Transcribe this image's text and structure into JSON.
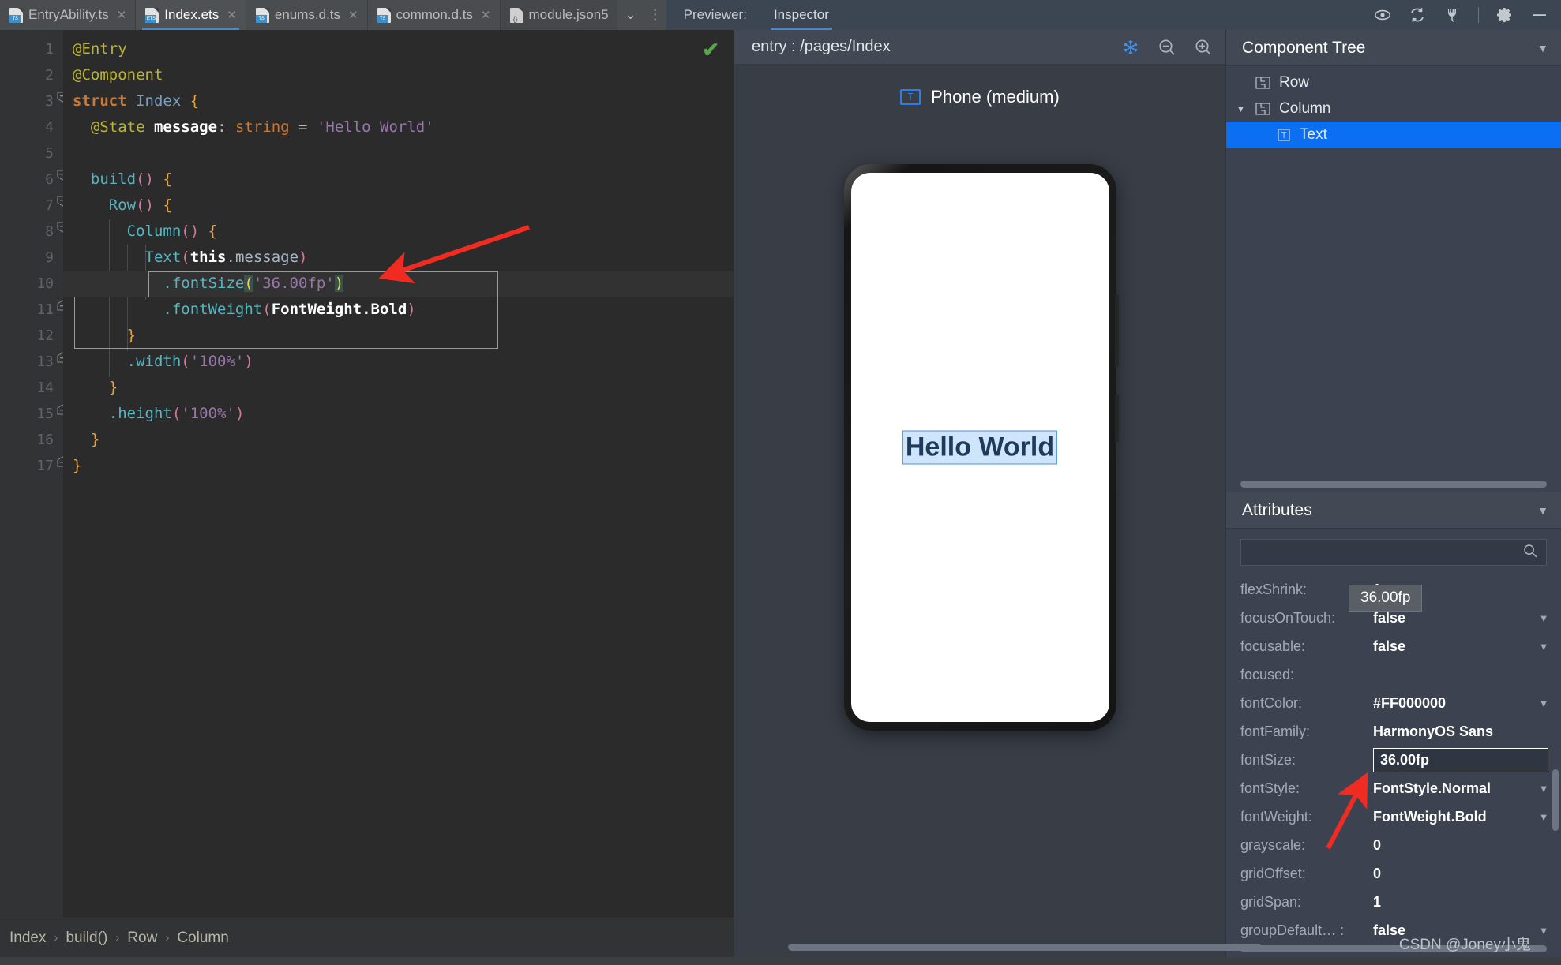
{
  "editor_tabs": [
    {
      "label": "EntryAbility.ts",
      "icon": "ts-file-icon",
      "badge": "TS",
      "active": false,
      "closable": true
    },
    {
      "label": "Index.ets",
      "icon": "ets-file-icon",
      "badge": "ETS",
      "active": true,
      "closable": true
    },
    {
      "label": "enums.d.ts",
      "icon": "ts-file-icon",
      "badge": "TS",
      "active": false,
      "closable": true
    },
    {
      "label": "common.d.ts",
      "icon": "ts-file-icon",
      "badge": "TS",
      "active": false,
      "closable": true
    },
    {
      "label": "module.json5",
      "icon": "json-file-icon",
      "badge": "{}",
      "active": false,
      "closable": false
    }
  ],
  "tab_overflow_caret": "⌄",
  "tab_more_dots": "⋮",
  "preview_header": {
    "previewer_label": "Previewer:",
    "inspector_tab": "Inspector",
    "icons": [
      "eye-icon",
      "refresh-icon",
      "plug-icon",
      "settings-icon",
      "minimize-icon"
    ]
  },
  "code": {
    "line_count": 17,
    "lines": [
      {
        "n": 1,
        "text": "@Entry"
      },
      {
        "n": 2,
        "text": "@Component"
      },
      {
        "n": 3,
        "text": "struct Index {"
      },
      {
        "n": 4,
        "text": "  @State message: string = 'Hello World'"
      },
      {
        "n": 5,
        "text": ""
      },
      {
        "n": 6,
        "text": "  build() {"
      },
      {
        "n": 7,
        "text": "    Row() {"
      },
      {
        "n": 8,
        "text": "      Column() {"
      },
      {
        "n": 9,
        "text": "        Text(this.message)"
      },
      {
        "n": 10,
        "text": "          .fontSize('36.00fp')"
      },
      {
        "n": 11,
        "text": "          .fontWeight(FontWeight.Bold)"
      },
      {
        "n": 12,
        "text": "      }"
      },
      {
        "n": 13,
        "text": "      .width('100%')"
      },
      {
        "n": 14,
        "text": "    }"
      },
      {
        "n": 15,
        "text": "    .height('100%')"
      },
      {
        "n": 16,
        "text": "  }"
      },
      {
        "n": 17,
        "text": "}"
      }
    ],
    "status_icon": "green-check-icon",
    "caret_line": 10
  },
  "breadcrumb": {
    "items": [
      "Index",
      "build()",
      "Row",
      "Column"
    ],
    "separator": "›"
  },
  "previewer": {
    "route_title": "entry : /pages/Index",
    "tools": [
      "freeze-icon",
      "zoom-out-icon",
      "zoom-in-icon"
    ],
    "device_label": "Phone (medium)",
    "device_icon": "text-component-icon",
    "screen_text": "Hello World"
  },
  "component_tree": {
    "title": "Component Tree",
    "collapse_caret": "▼",
    "nodes": [
      {
        "label": "Row",
        "depth": 0,
        "icon": "layout-component-icon",
        "expandable": false,
        "selected": false
      },
      {
        "label": "Column",
        "depth": 0,
        "icon": "layout-component-icon",
        "expandable": true,
        "selected": false
      },
      {
        "label": "Text",
        "depth": 1,
        "icon": "text-component-icon",
        "expandable": false,
        "selected": true
      }
    ]
  },
  "attributes": {
    "title": "Attributes",
    "collapse_caret": "▼",
    "search_placeholder": "",
    "search_value": "",
    "search_icon": "search-icon",
    "rows": [
      {
        "key": "flexShrink:",
        "value": "1",
        "dropdown": false,
        "editing": false
      },
      {
        "key": "focusOnTouch:",
        "value": "false",
        "dropdown": true,
        "editing": false
      },
      {
        "key": "focusable:",
        "value": "false",
        "dropdown": true,
        "editing": false
      },
      {
        "key": "focused:",
        "value": "",
        "dropdown": false,
        "editing": false
      },
      {
        "key": "fontColor:",
        "value": "#FF000000",
        "dropdown": true,
        "editing": false
      },
      {
        "key": "fontFamily:",
        "value": "HarmonyOS Sans",
        "dropdown": false,
        "editing": false
      },
      {
        "key": "fontSize:",
        "value": "36.00fp",
        "dropdown": false,
        "editing": true
      },
      {
        "key": "fontStyle:",
        "value": "FontStyle.Normal",
        "dropdown": true,
        "editing": false
      },
      {
        "key": "fontWeight:",
        "value": "FontWeight.Bold",
        "dropdown": true,
        "editing": false
      },
      {
        "key": "grayscale:",
        "value": "0",
        "dropdown": false,
        "editing": false
      },
      {
        "key": "gridOffset:",
        "value": "0",
        "dropdown": false,
        "editing": false
      },
      {
        "key": "gridSpan:",
        "value": "1",
        "dropdown": false,
        "editing": false
      },
      {
        "key": "groupDefault… :",
        "value": "false",
        "dropdown": true,
        "editing": false
      }
    ],
    "tooltip": "36.00fp"
  },
  "annotations": {
    "arrow_color": "#ef2b22",
    "code_arrow": "code-fontsize-arrow",
    "attr_arrow": "attributes-fontsize-arrow"
  },
  "watermark": "CSDN @Joney小鬼",
  "colors": {
    "accent_blue": "#4a88c7",
    "selection_blue": "#0a6ff0",
    "editor_bg": "#2b2b2b",
    "panel_bg": "#3c4250",
    "preview_bg": "#383d46"
  }
}
